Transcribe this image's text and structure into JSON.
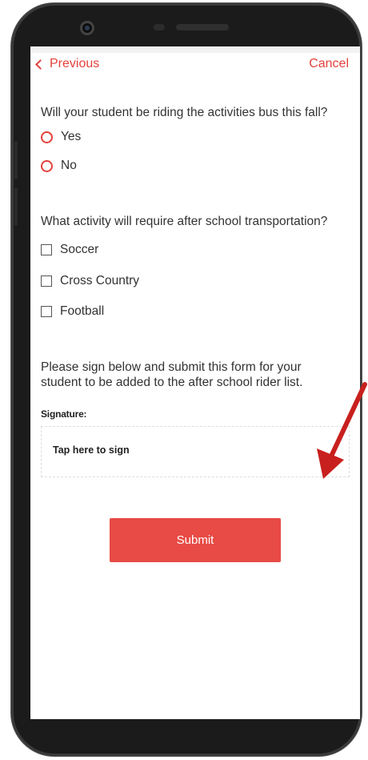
{
  "nav": {
    "previous_label": "Previous",
    "cancel_label": "Cancel"
  },
  "question1": {
    "text": "Will your student be riding the activities bus this fall?",
    "options": [
      "Yes",
      "No"
    ]
  },
  "question2": {
    "text": "What activity will require after school transportation?",
    "options": [
      "Soccer",
      "Cross Country",
      "Football"
    ]
  },
  "instructions": {
    "line1": "Please sign below and submit this form for your",
    "line2": "student to be added to the after school rider list."
  },
  "signature": {
    "label": "Signature:",
    "placeholder": "Tap here to sign"
  },
  "submit_label": "Submit",
  "colors": {
    "accent": "#e3413b",
    "button": "#e84a45",
    "annotation_arrow": "#c8201e"
  },
  "icons": [
    "chevron-left-icon",
    "radio-button-icon",
    "checkbox-icon",
    "annotation-arrow-icon"
  ]
}
